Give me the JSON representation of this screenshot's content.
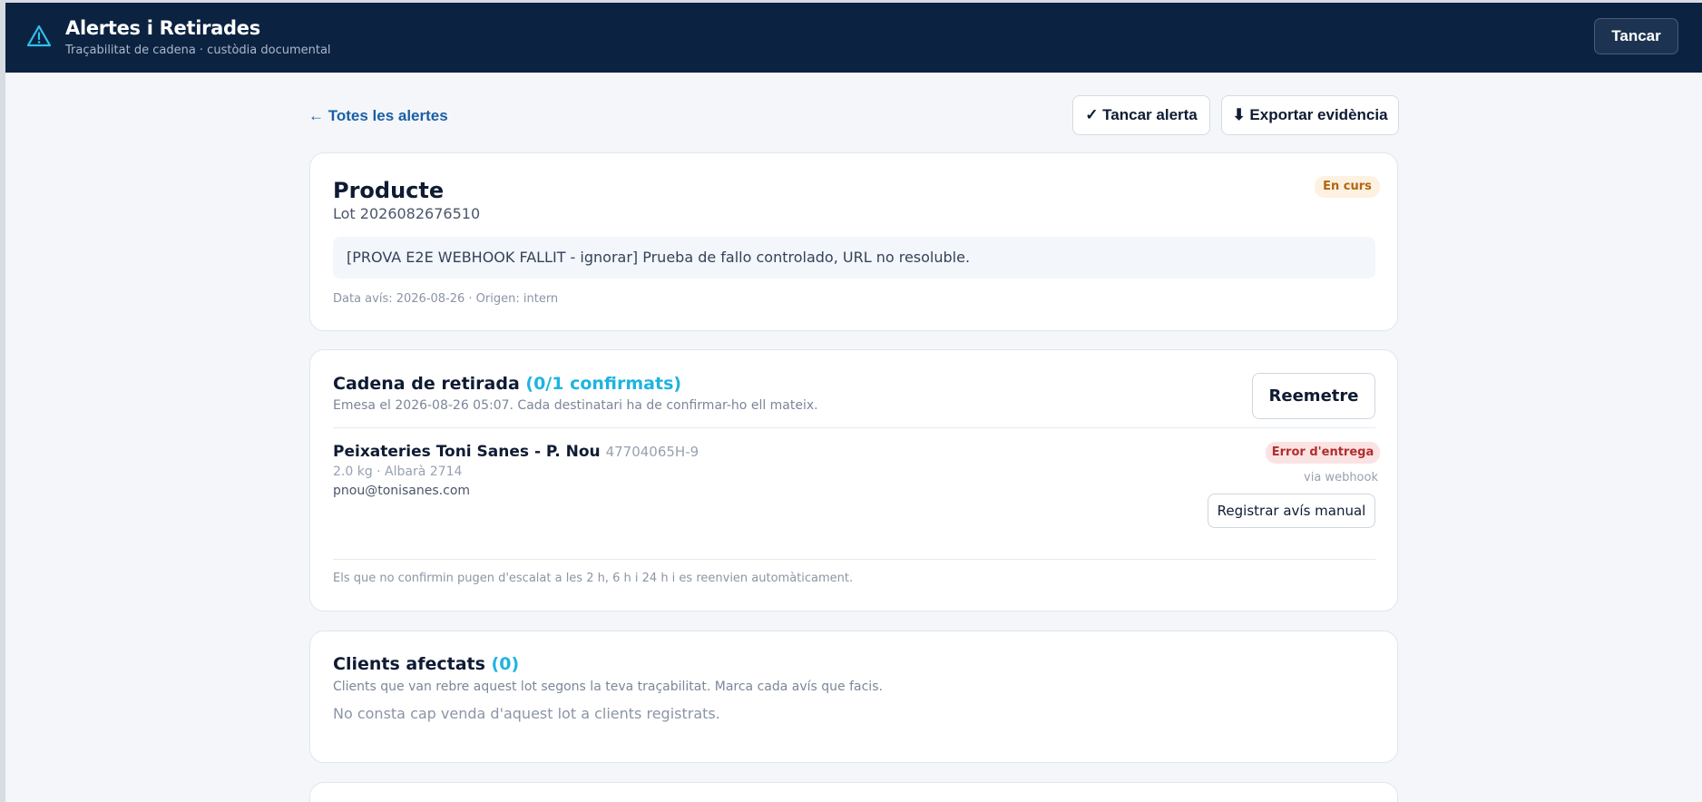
{
  "header": {
    "title": "Alertes i Retirades",
    "subtitle": "Traçabilitat de cadena · custòdia documental",
    "close_label": "Tancar",
    "icon": "warning-triangle-icon",
    "background": "#0c2241"
  },
  "toolbar": {
    "back_label": "← Totes les alertes",
    "close_alert_label": "✓ Tancar alerta",
    "export_label": "⬇ Exportar evidència"
  },
  "product": {
    "title": "Producte",
    "lot": "Lot 2026082676510",
    "status": "En curs",
    "description": "[PROVA E2E WEBHOOK FALLIT - ignorar] Prueba de fallo controlado, URL no resoluble.",
    "meta": "Data avís: 2026-08-26 · Origen: intern"
  },
  "chain": {
    "title": "Cadena de retirada",
    "count": "(0/1 confirmats)",
    "subtitle": "Emesa el 2026-08-26 05:07. Cada destinatari ha de confirmar-ho ell mateix.",
    "resend_label": "Reemetre",
    "recipients": [
      {
        "name": "Peixateries Toni Sanes - P. Nou",
        "tax_id": "47704065H-9",
        "detail": "2.0 kg · Albarà 2714",
        "email": "pnou@tonisanes.com",
        "status": "Error d'entrega",
        "channel": "via webhook",
        "manual_label": "Registrar avís manual"
      }
    ],
    "footer": "Els que no confirmin pugen d'escalat a les 2 h, 6 h i 24 h i es reenvien automàticament."
  },
  "clients": {
    "title": "Clients afectats",
    "count": "(0)",
    "subtitle": "Clients que van rebre aquest lot segons la teva traçabilitat. Marca cada avís que facis.",
    "empty": "No consta cap venda d'aquest lot a clients registrats."
  },
  "colors": {
    "accent": "#1eb4e0",
    "status_pending_bg": "#fdf1e1",
    "status_pending_text": "#b4650f",
    "status_error_bg": "#fbe3e3",
    "status_error_text": "#b12e2e"
  }
}
